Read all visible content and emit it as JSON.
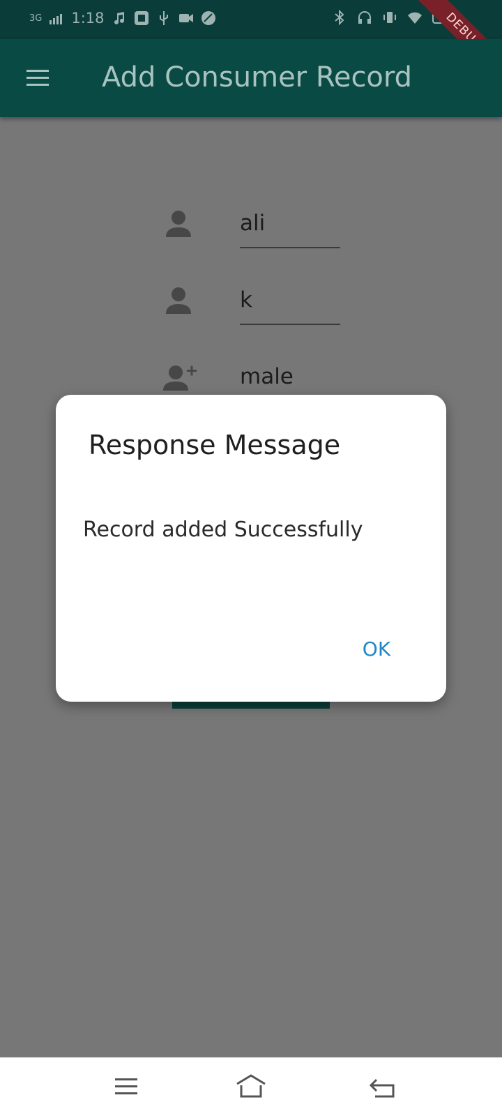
{
  "status_bar": {
    "network": "3G",
    "time": "1:18",
    "debug_label": "DEBUG"
  },
  "app_bar": {
    "title": "Add Consumer Record",
    "menu_icon": "menu-icon"
  },
  "form": {
    "fields": [
      {
        "icon": "person-icon",
        "value": "ali"
      },
      {
        "icon": "person-icon",
        "value": "k"
      },
      {
        "icon": "person-add-icon",
        "value": "male"
      }
    ]
  },
  "dialog": {
    "title": "Response Message",
    "message": "Record added Successfully",
    "ok_label": "OK",
    "ok_color": "#1e88c8"
  },
  "nav_bar": {
    "buttons": [
      "menu-icon",
      "home-icon",
      "back-icon"
    ]
  },
  "colors": {
    "app_bar": "#0a4a44",
    "status_bar": "#0a3d3a",
    "scrim": "#777777",
    "debug_ribbon": "#7a2028"
  }
}
